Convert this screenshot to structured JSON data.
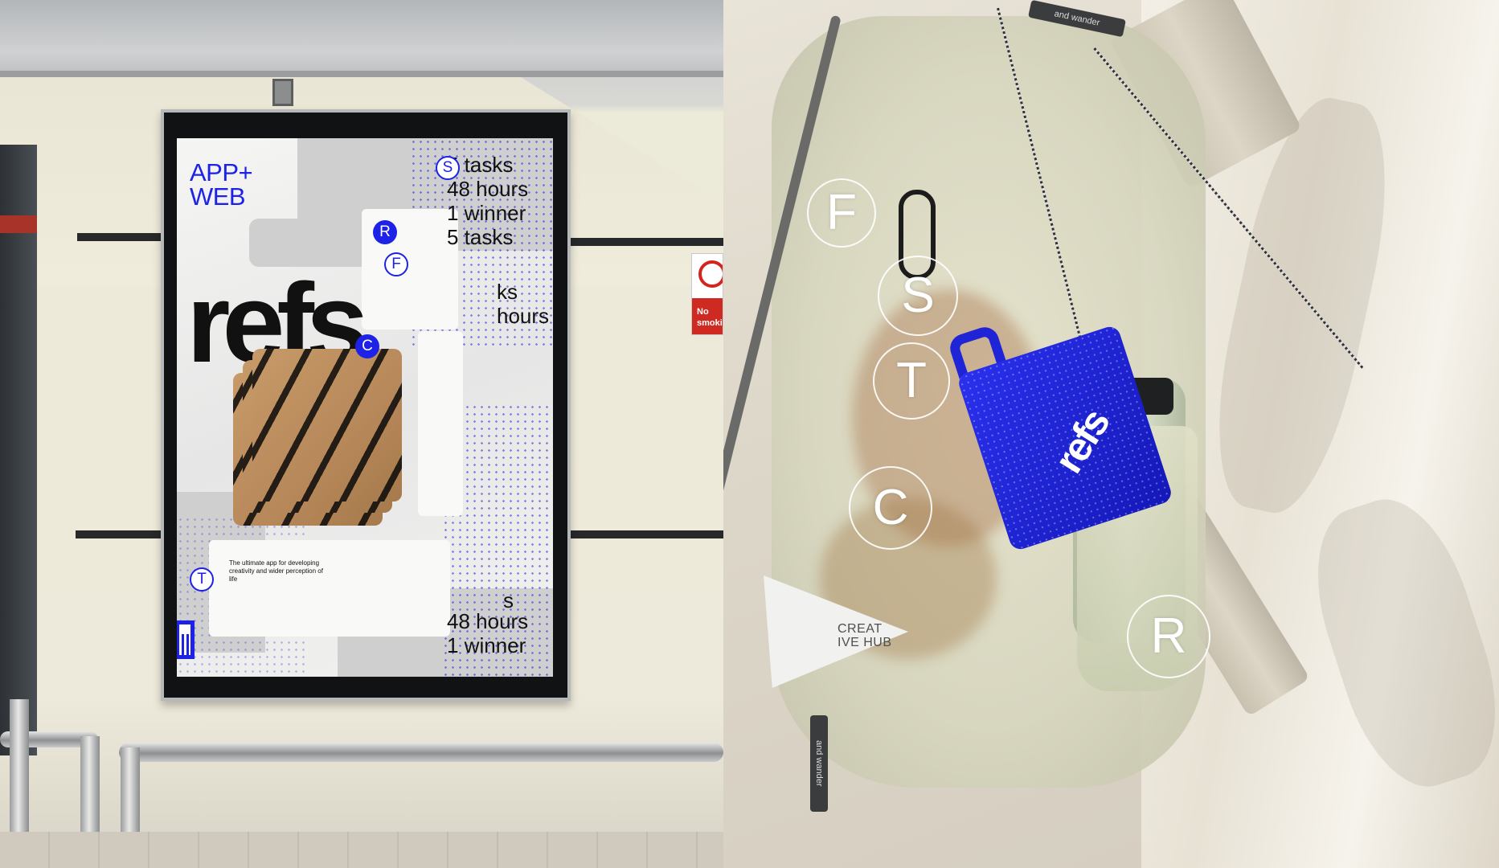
{
  "poster": {
    "platform_line1": "APP+",
    "platform_line2": "WEB",
    "stats_top": [
      "5 tasks",
      "48 hours",
      "1 winner",
      "5 tasks"
    ],
    "stats_mid": [
      "ks",
      "hours"
    ],
    "stats_bottom": [
      "s",
      "48 hours",
      "1 winner"
    ],
    "brand": "refs",
    "badges": [
      "S",
      "R",
      "F",
      "C",
      "T"
    ],
    "tagline": "The ultimate app for developing creativity and wider perception of life"
  },
  "sign": {
    "text": "No smoking"
  },
  "backpack": {
    "circle_letters": [
      "F",
      "S",
      "T",
      "C",
      "R"
    ],
    "tag_text_line1": "CREAT",
    "tag_text_line2": "IVE HUB",
    "mug_brand": "refs",
    "strap_brand_top": "and wander",
    "strap_brand_bottom": "and wander"
  },
  "colors": {
    "accent_blue": "#1d22e6",
    "poster_background": "#f2f2f0",
    "backpack_fabric": "#dcdabf"
  }
}
